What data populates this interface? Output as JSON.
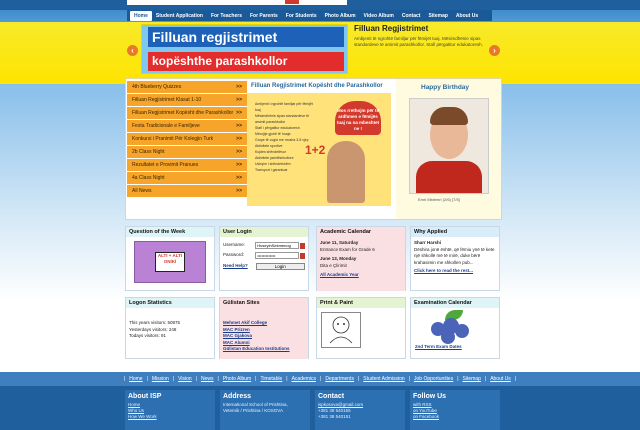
{
  "nav": {
    "items": [
      "Home",
      "Student Application",
      "For Teachers",
      "For Parents",
      "For Students",
      "Photo Album",
      "Video Album",
      "Contact",
      "Sitemap",
      "About Us"
    ]
  },
  "banner": {
    "image_line1": "Filluan regjistrimet",
    "image_line2": "kopështhe parashkollor",
    "title": "Filluan Regjistrimet",
    "text": "Ambjenti të ngrohtë familjar për fëmijët tuaj. Mësimdhënie sipas standardeve të arsimit parashkollor. Stafi përgatitur edukatoresh.",
    "arrow_left": "‹",
    "arrow_right": "›"
  },
  "menu": {
    "arrow": ">>",
    "items": [
      "4th Blueberry Quizzes",
      "Filluan Regjistrimet Klasat 1-10",
      "Filluan Regjistrimet Kopësht dhe Parashkollor",
      "Festa Tradicionale e Familjeve",
      "Konkursi i Pranimit Për Kolegjin Turk",
      "2b Class Night",
      "Rezultatet e Provimit Pranues",
      "4a Class Night",
      "All News"
    ]
  },
  "feature": {
    "title": "Filluan Regjistrimet Kopësht dhe Parashkollor",
    "heart_text": "Mos rrethojm për të ardhmen e fëmijës tuaj na na mbeshtet ne !",
    "math": "1+2",
    "bullets": [
      "Ambjenti i ngrohtë familjar për fëmijët tuaj",
      "Mësimdhënie sipas standardeve të arsimit parashkollor",
      "Stafi i përgatitur edukatoresh",
      "Mbrojtje gjuhë të huaja",
      "Grupe të vogla me mosha 3-5 vjeç",
      "Aktivitete sportive",
      "Kujdes shëndetësor",
      "Aktivitete jashtëshkollore",
      "Ushqim i shëndetshëm",
      "Transport i garantuar"
    ]
  },
  "birthday": {
    "title": "Happy Birthday",
    "caption": "Emri Mbiemri (2/6) [7/5]"
  },
  "boxes": {
    "qotw": {
      "title": "Question of the Week",
      "img_text": "ALTI + ALTI ONİKİ"
    },
    "login": {
      "title": "User Login",
      "username_label": "Username:",
      "username_value": "HuseyinSekmenog",
      "password_label": "Password:",
      "password_value": "•••••••••••••",
      "help": "Need Help?",
      "button": "Login"
    },
    "calendar": {
      "title": "Academic Calendar",
      "e1_date": "June 11, Saturday",
      "e1_text": "Entrance Exam for Grade 6",
      "e2_date": "June 13, Monday",
      "e2_text": "Dita e Çlirimit",
      "link": "All Academic Year"
    },
    "why": {
      "title": "Why Applied",
      "name": "Sharr Harshi",
      "text": "Dëshira jonë është, që fëmiu ynë të kete një shkollë më të mirë, duke bërë krahasimin me shkollen pub...",
      "link": "Click here to read the rest..."
    },
    "stats": {
      "title": "Logon Statistics",
      "l1": "This years visitors: 50875",
      "l2": "Yesterdays visitors: 248",
      "l3": "Todays visitors: 91"
    },
    "sites": {
      "title": "Gülistan Sites",
      "links": [
        "Mehmet Akif College",
        "MAC Prizren",
        "MAC Gjakova",
        "MAC Alumni",
        "Gülistan Education Institutions"
      ]
    },
    "paint": {
      "title": "Print & Paint"
    },
    "exam": {
      "title": "Examination Calendar",
      "link": "2nd Term Exam Dates"
    }
  },
  "footer_nav": [
    "Home",
    "Mission",
    "Vision",
    "News",
    "Photo Album",
    "Timetable",
    "Academics",
    "Departments",
    "Student Admission",
    "Job Opportunities",
    "Sitemap",
    "About Us"
  ],
  "footer": {
    "about": {
      "title": "About ISP",
      "items": [
        "Home",
        "Who Us",
        "How We Work"
      ]
    },
    "address": {
      "title": "Address",
      "items": [
        "International School of Prishtina,",
        "Veternik / Prishtina / KOSOVA"
      ]
    },
    "contact": {
      "title": "Contact",
      "items": [
        "ispkosova@gmail.com",
        "+381 38 540155",
        "+381 38 540151"
      ]
    },
    "follow": {
      "title": "Follow Us",
      "items": [
        "with RSS",
        "on YouTube",
        "on Facebook"
      ]
    }
  },
  "colors": {
    "nav": "#1b5a99",
    "banner": "#ffe400",
    "menu": "#f6a52a",
    "footer": "#1f5f9e"
  }
}
